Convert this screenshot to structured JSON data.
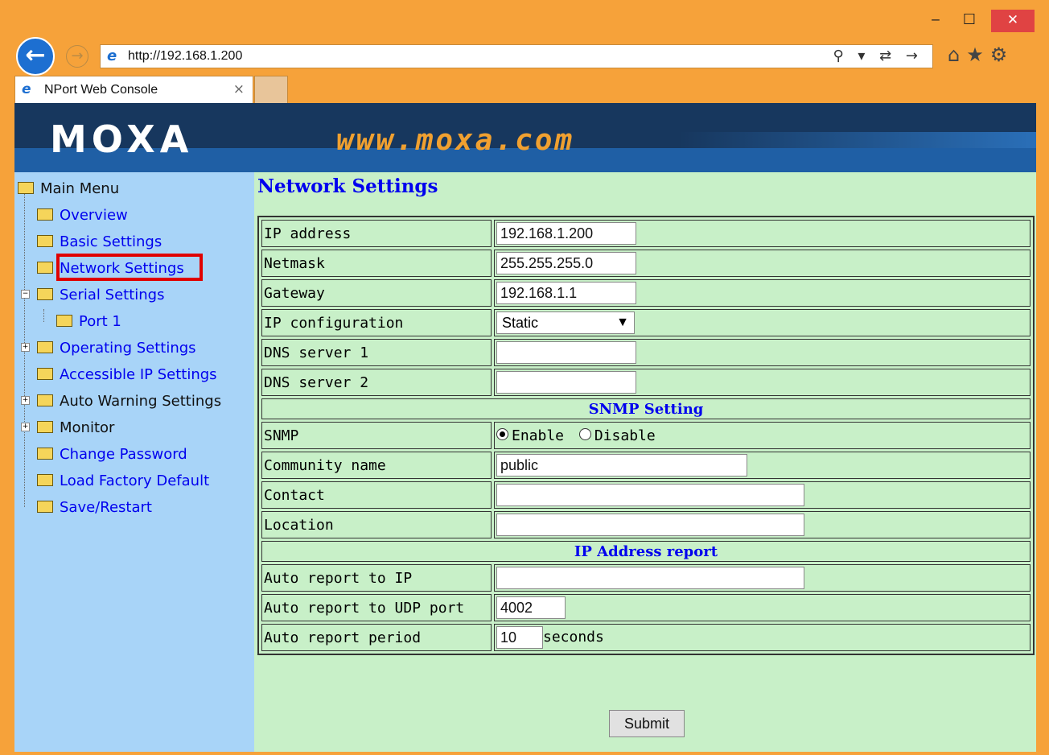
{
  "browser": {
    "url": "http://192.168.1.200",
    "tab_title": "NPort Web Console",
    "tab_close": "×",
    "win_min": "‒",
    "win_max": "☐",
    "win_close": "✕",
    "search_tools": "⚲ ▾ ⇄ →",
    "top_icons": "⌂★⚙"
  },
  "banner": {
    "logo": "MOXA",
    "site": "www.moxa.com"
  },
  "sidebar": {
    "root": "Main Menu",
    "items": [
      "Overview",
      "Basic Settings",
      "Network Settings",
      "Serial Settings",
      "Port 1",
      "Operating Settings",
      "Accessible IP Settings",
      "Auto Warning Settings",
      "Monitor",
      "Change Password",
      "Load Factory Default",
      "Save/Restart"
    ]
  },
  "content": {
    "title": "Network Settings",
    "fields": {
      "ip_label": "IP address",
      "ip_value": "192.168.1.200",
      "netmask_label": "Netmask",
      "netmask_value": "255.255.255.0",
      "gateway_label": "Gateway",
      "gateway_value": "192.168.1.1",
      "ipconf_label": "IP configuration",
      "ipconf_value": "Static",
      "dns1_label": "DNS server 1",
      "dns1_value": "",
      "dns2_label": "DNS server 2",
      "dns2_value": "",
      "snmp_section": "SNMP Setting",
      "snmp_label": "SNMP",
      "snmp_enable": "Enable",
      "snmp_disable": "Disable",
      "community_label": "Community name",
      "community_value": "public",
      "contact_label": "Contact",
      "contact_value": "",
      "location_label": "Location",
      "location_value": "",
      "report_section": "IP Address report",
      "report_ip_label": "Auto report to IP",
      "report_ip_value": "",
      "report_udp_label": "Auto report to UDP port",
      "report_udp_value": "4002",
      "report_period_label": "Auto report period",
      "report_period_value": "10",
      "report_period_unit": "seconds"
    },
    "snmp_selected": "Enable",
    "submit": "Submit"
  },
  "colors": {
    "window_frame": "#f6a23a",
    "banner": "#17375e",
    "sidebar": "#a8d4f8",
    "content_bg": "#c8f0c8",
    "link": "#0000ee",
    "highlight_box": "#e00000"
  }
}
